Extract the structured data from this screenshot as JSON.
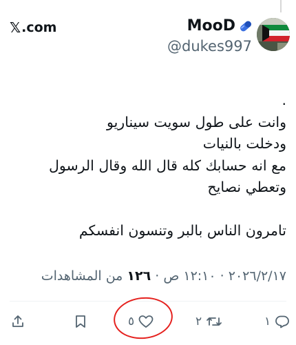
{
  "site": {
    "x_mark": "𝕏",
    "domain": ".com"
  },
  "author": {
    "name": "MooD",
    "handle": "@dukes997",
    "badge_icon": "capsule-icon"
  },
  "tweet": {
    "lines": [
      ".",
      "وانت على طول سويت سيناريو",
      "ودخلت بالنيات",
      "مع انه حسابك كله قال الله وقال الرسول",
      "وتعطي نصايح",
      "",
      "تامرون الناس بالبر وتنسون انفسكم"
    ]
  },
  "meta": {
    "date": "٢٠٢٦/٢/١٧",
    "separator": "·",
    "time": "١٢:١٠ ص",
    "views_count": "١٢٦",
    "views_label": "من المشاهدات"
  },
  "actions": {
    "reply_count": "١",
    "retweet_count": "٢",
    "like_count": "٥",
    "icons": [
      "reply-icon",
      "retweet-icon",
      "heart-icon",
      "bookmark-icon",
      "share-icon"
    ]
  },
  "colors": {
    "accent": "#e5211e",
    "muted": "#536471",
    "text": "#0f1419"
  }
}
